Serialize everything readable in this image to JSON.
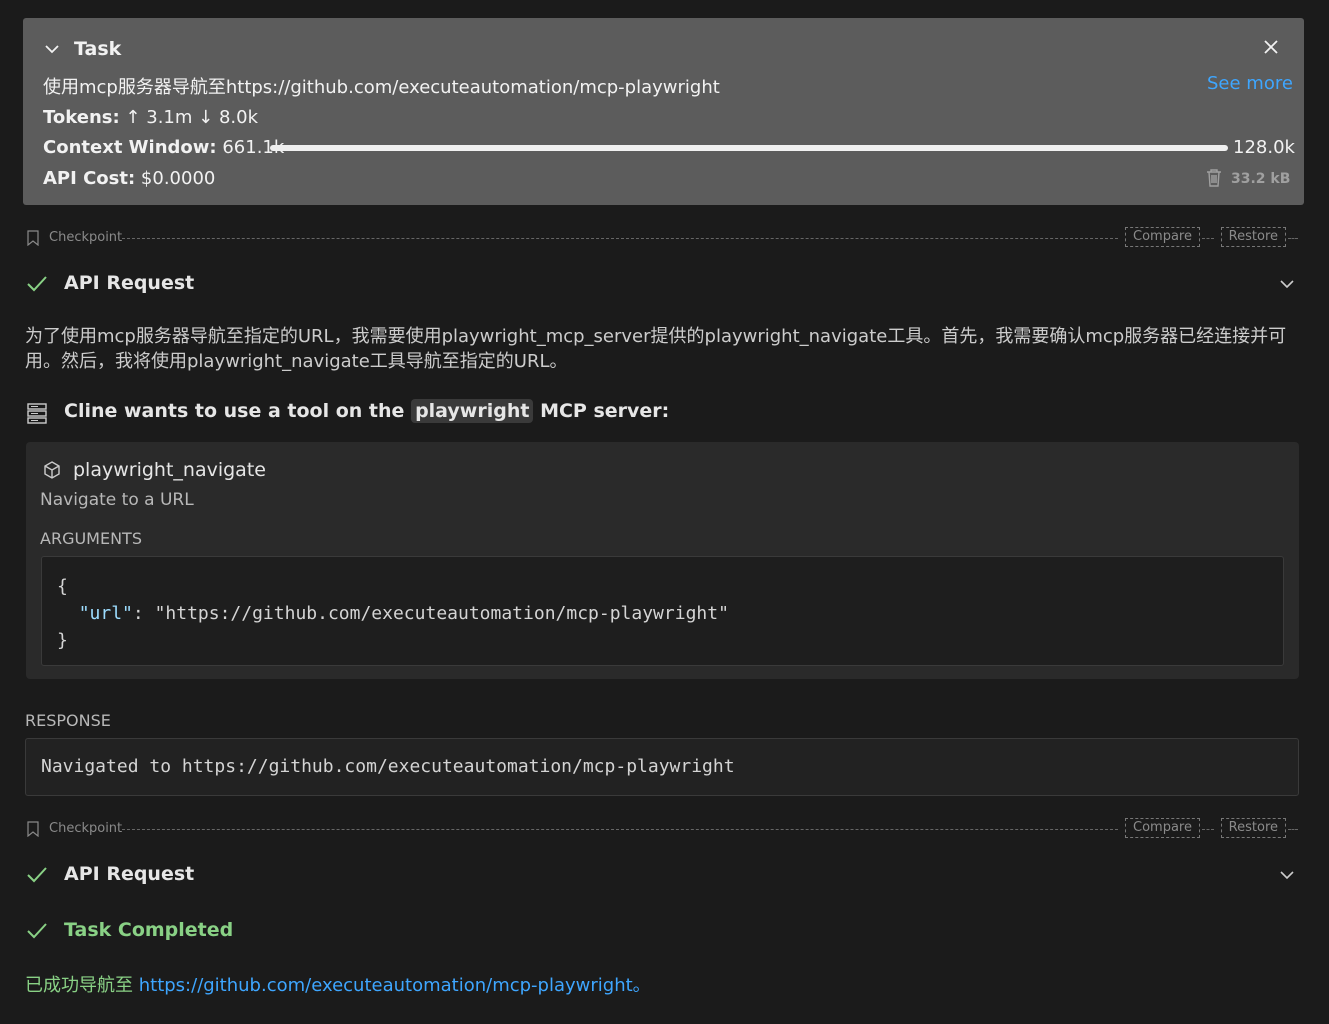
{
  "task": {
    "title": "Task",
    "description": "使用mcp服务器导航至https://github.com/executeautomation/mcp-playwright",
    "see_more": "See more",
    "tokens_label": "Tokens:",
    "tokens_up": "3.1m",
    "tokens_down": "8.0k",
    "context_label": "Context Window:",
    "context_used": "661.1k",
    "context_max": "128.0k",
    "context_fill": 1.0,
    "cost_label": "API Cost:",
    "cost_value": "$0.0000",
    "size": "33.2 kB"
  },
  "checkpoint": {
    "label": "Checkpoint",
    "compare": "Compare",
    "restore": "Restore"
  },
  "api_request_1": {
    "title": "API Request"
  },
  "thinking_text": "为了使用mcp服务器导航至指定的URL，我需要使用playwright_mcp_server提供的playwright_navigate工具。首先，我需要确认mcp服务器已经连接并可用。然后，我将使用playwright_navigate工具导航至指定的URL。",
  "mcp": {
    "prefix": "Cline wants to use a tool on the",
    "server": "playwright",
    "suffix": "MCP server:",
    "tool_name": "playwright_navigate",
    "tool_desc": "Navigate to a URL",
    "args_label": "ARGUMENTS",
    "arg_key": "\"url\"",
    "arg_value": "\"https://github.com/executeautomation/mcp-playwright\"",
    "brace_open": "{",
    "brace_close": "}",
    "colon": ": "
  },
  "response": {
    "label": "RESPONSE",
    "text": "Navigated to https://github.com/executeautomation/mcp-playwright"
  },
  "api_request_2": {
    "title": "API Request"
  },
  "completed": {
    "title": "Task Completed",
    "prefix": "已成功导航至 ",
    "link": "https://github.com/executeautomation/mcp-playwright。"
  },
  "colors": {
    "accent": "#3ea6ff",
    "success": "#89d185",
    "panel": "#5c5c5c"
  }
}
